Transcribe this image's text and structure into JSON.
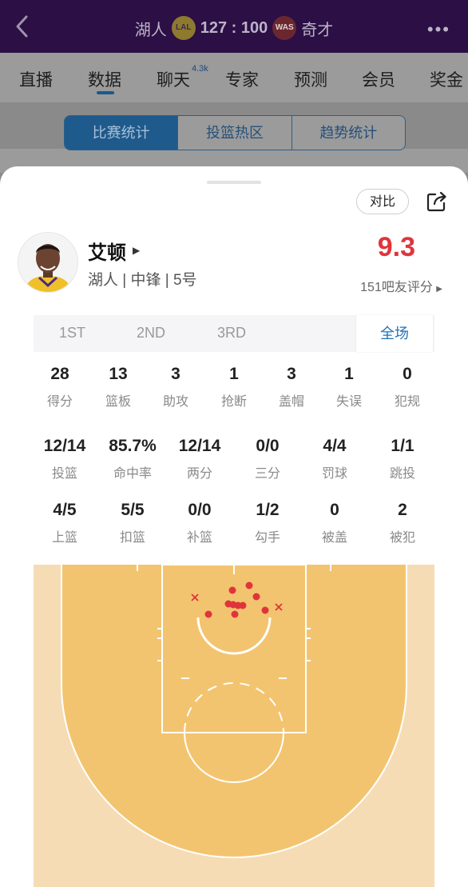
{
  "header": {
    "home_team": "湖人",
    "home_logo": "LAL",
    "score": "127 : 100",
    "away_logo": "WAS",
    "away_team": "奇才",
    "more": "•••"
  },
  "nav": {
    "tabs": [
      "直播",
      "数据",
      "聊天",
      "专家",
      "预测",
      "会员",
      "奖金"
    ],
    "chat_badge": "4.3k"
  },
  "subtabs": [
    "比赛统计",
    "投篮热区",
    "趋势统计"
  ],
  "sheet": {
    "compare_label": "对比",
    "player_name": "艾顿",
    "player_info": "湖人 | 中锋 | 5号",
    "rating": "9.3",
    "rating_count": "151吧友评分",
    "periods": [
      "1ST",
      "2ND",
      "3RD",
      "全场"
    ],
    "stats_row1": [
      {
        "value": "28",
        "label": "得分"
      },
      {
        "value": "13",
        "label": "篮板"
      },
      {
        "value": "3",
        "label": "助攻"
      },
      {
        "value": "1",
        "label": "抢断"
      },
      {
        "value": "3",
        "label": "盖帽"
      },
      {
        "value": "1",
        "label": "失误"
      },
      {
        "value": "0",
        "label": "犯规"
      }
    ],
    "stats_row2": [
      {
        "value": "12/14",
        "label": "投篮"
      },
      {
        "value": "85.7%",
        "label": "命中率"
      },
      {
        "value": "12/14",
        "label": "两分"
      },
      {
        "value": "0/0",
        "label": "三分"
      },
      {
        "value": "4/4",
        "label": "罚球"
      },
      {
        "value": "1/1",
        "label": "跳投"
      }
    ],
    "stats_row3": [
      {
        "value": "4/5",
        "label": "上篮"
      },
      {
        "value": "5/5",
        "label": "扣篮"
      },
      {
        "value": "0/0",
        "label": "补篮"
      },
      {
        "value": "1/2",
        "label": "勾手"
      },
      {
        "value": "0",
        "label": "被盖"
      },
      {
        "value": "2",
        "label": "被犯"
      }
    ]
  },
  "colors": {
    "accent": "#1e72b8",
    "rating": "#e0343c",
    "court": "#f3c46f",
    "court_outer": "#f5dcb5",
    "made_shot": "#e0343c",
    "missed_shot": "#e0343c"
  },
  "icons": {
    "back": "back-arrow-icon",
    "share": "share-icon",
    "avatar": "player-avatar"
  }
}
